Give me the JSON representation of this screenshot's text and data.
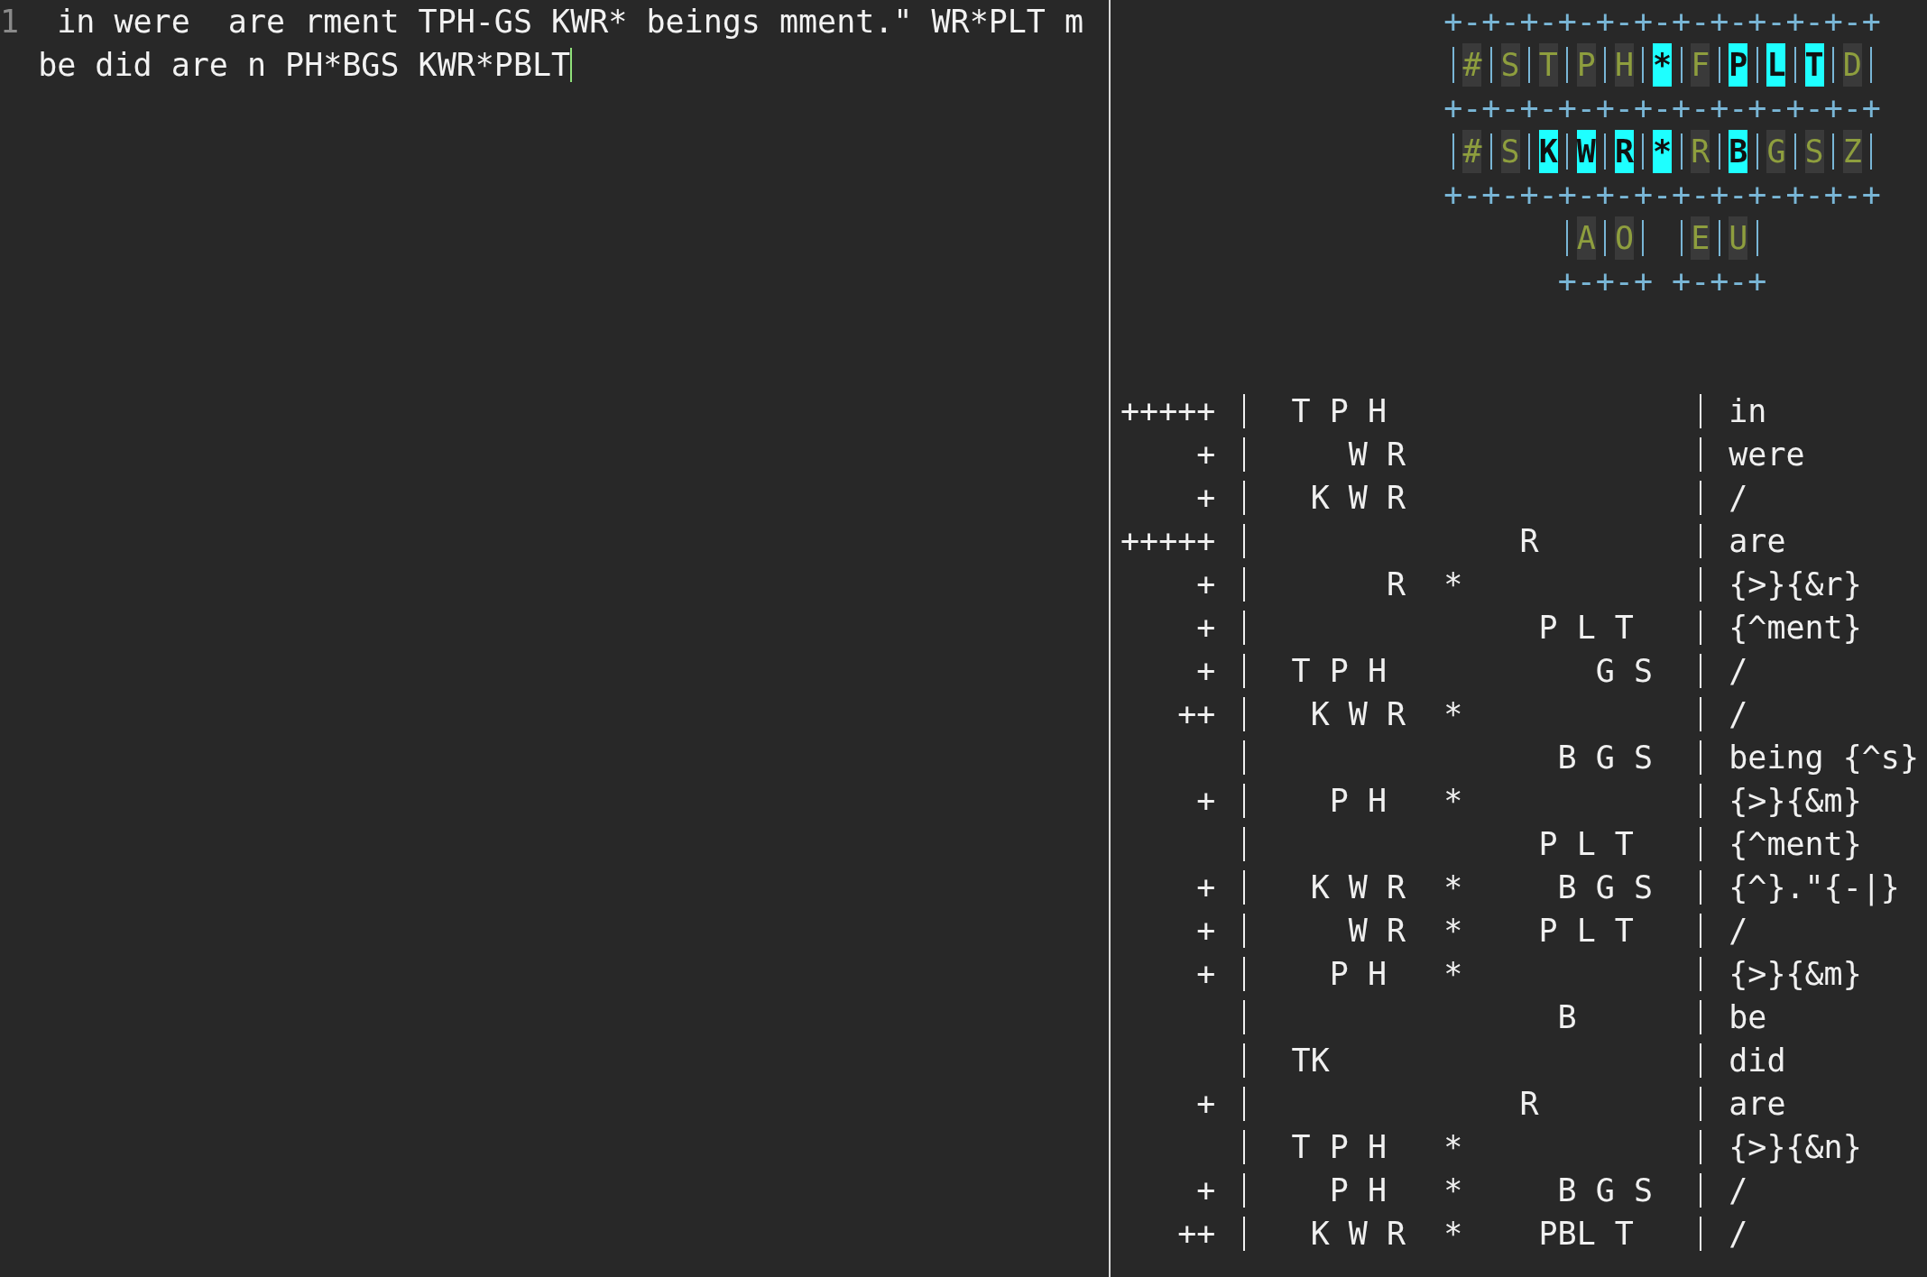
{
  "editor": {
    "line_number": "1",
    "lines": [
      " in were  are rment TPH-GS KWR* beings mment.\" WR*PLT m",
      "be did are n PH*BGS KWR*PBLT"
    ]
  },
  "steno_keyboard": {
    "rows": [
      {
        "kind": "border",
        "text": "+-+-+-+-+-+-+-+-+-+-+-+"
      },
      {
        "kind": "keys",
        "groups": [
          {
            "keys": [
              {
                "label": "#",
                "pressed": false
              },
              {
                "label": "S",
                "pressed": false
              },
              {
                "label": "T",
                "pressed": false
              },
              {
                "label": "P",
                "pressed": false
              },
              {
                "label": "H",
                "pressed": false
              },
              {
                "label": "*",
                "pressed": true
              },
              {
                "label": "F",
                "pressed": false
              },
              {
                "label": "P",
                "pressed": true
              },
              {
                "label": "L",
                "pressed": true
              },
              {
                "label": "T",
                "pressed": true
              },
              {
                "label": "D",
                "pressed": false
              }
            ]
          }
        ]
      },
      {
        "kind": "border",
        "text": "+-+-+-+-+-+-+-+-+-+-+-+"
      },
      {
        "kind": "keys",
        "groups": [
          {
            "keys": [
              {
                "label": "#",
                "pressed": false
              },
              {
                "label": "S",
                "pressed": false
              },
              {
                "label": "K",
                "pressed": true
              },
              {
                "label": "W",
                "pressed": true
              },
              {
                "label": "R",
                "pressed": true
              },
              {
                "label": "*",
                "pressed": true
              },
              {
                "label": "R",
                "pressed": false
              },
              {
                "label": "B",
                "pressed": true
              },
              {
                "label": "G",
                "pressed": false
              },
              {
                "label": "S",
                "pressed": false
              },
              {
                "label": "Z",
                "pressed": false
              }
            ]
          }
        ]
      },
      {
        "kind": "border",
        "text": "+-+-+-+-+-+-+-+-+-+-+-+"
      },
      {
        "kind": "keys",
        "groups": [
          {
            "keys": [
              {
                "label": "A",
                "pressed": false
              },
              {
                "label": "O",
                "pressed": false
              }
            ]
          },
          {
            "keys": [
              {
                "label": "E",
                "pressed": false
              },
              {
                "label": "U",
                "pressed": false
              }
            ]
          }
        ]
      },
      {
        "kind": "border",
        "text": "+-+-+ +-+-+"
      }
    ]
  },
  "paper_tape": {
    "rows": [
      {
        "marker": "+++++",
        "steno": "  T P H",
        "translation": "in"
      },
      {
        "marker": "+",
        "steno": "     W R",
        "translation": "were"
      },
      {
        "marker": "+",
        "steno": "   K W R",
        "translation": "/"
      },
      {
        "marker": "+++++",
        "steno": "              R",
        "translation": "are"
      },
      {
        "marker": "+",
        "steno": "       R  *",
        "translation": "{>}{&r}"
      },
      {
        "marker": "+",
        "steno": "               P L T",
        "translation": "{^ment}"
      },
      {
        "marker": "+",
        "steno": "  T P H           G S",
        "translation": "/"
      },
      {
        "marker": "++",
        "steno": "   K W R  *",
        "translation": "/"
      },
      {
        "steno": "                B G S",
        "translation": "being {^s}"
      },
      {
        "marker": "+",
        "steno": "    P H   *",
        "translation": "{>}{&m}"
      },
      {
        "steno": "               P L T",
        "translation": "{^ment}"
      },
      {
        "marker": "+",
        "steno": "   K W R  *     B G S",
        "translation": "{^}.\"{-|}"
      },
      {
        "marker": "+",
        "steno": "     W R  *    P L T",
        "translation": "/"
      },
      {
        "marker": "+",
        "steno": "    P H   *",
        "translation": "{>}{&m}"
      },
      {
        "steno": "                B",
        "translation": "be"
      },
      {
        "steno": "  TK",
        "translation": "did"
      },
      {
        "marker": "+",
        "steno": "              R",
        "translation": "are"
      },
      {
        "steno": "  T P H   *",
        "translation": "{>}{&n}"
      },
      {
        "marker": "+",
        "steno": "    P H   *     B G S",
        "translation": "/"
      },
      {
        "marker": "++",
        "steno": "   K W R  *    PBL T",
        "translation": "/"
      }
    ]
  }
}
